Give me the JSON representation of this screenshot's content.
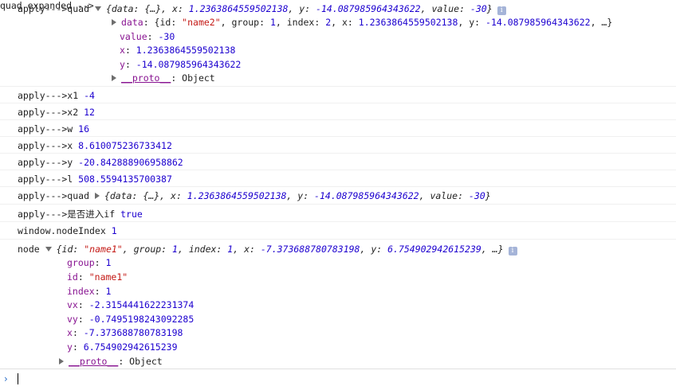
{
  "messages": {
    "m1": {
      "label": "apply--->quad ",
      "summary": {
        "p1": "{data: {…}, x: ",
        "x": "1.2363864559502138",
        "p2": ", y: ",
        "y": "-14.087985964343622",
        "p3": ", value: ",
        "value": "-30",
        "p4": "}"
      },
      "data_line": {
        "key": "data",
        "p1": ": {id: ",
        "id": "\"name2\"",
        "p2": ", group: ",
        "group": "1",
        "p3": ", index: ",
        "index": "2",
        "p4": ", x: ",
        "x": "1.2363864559502138",
        "p5": ", y: ",
        "y": "-14.087985964343622",
        "p6": ", …}"
      },
      "value_key": "value",
      "value_val": "-30",
      "x_key": "x",
      "x_val": "1.2363864559502138",
      "y_key": "y",
      "y_val": "-14.087985964343622",
      "proto_key": "__proto__",
      "proto_val": "Object"
    },
    "m2": {
      "label": "apply--->x1 ",
      "value": "-4"
    },
    "m3": {
      "label": "apply--->x2 ",
      "value": "12"
    },
    "m4": {
      "label": "apply--->w ",
      "value": "16"
    },
    "m5": {
      "label": "apply--->x ",
      "value": "8.610075236733412"
    },
    "m6": {
      "label": "apply--->y ",
      "value": "-20.842888906958862"
    },
    "m7": {
      "label": "apply--->l ",
      "value": "508.5594135700387"
    },
    "m8": {
      "label": "apply--->quad ",
      "p1": "{data: {…}, x: ",
      "x": "1.2363864559502138",
      "p2": ", y: ",
      "y": "-14.087985964343622",
      "p3": ", value: ",
      "value": "-30",
      "p4": "}"
    },
    "m9": {
      "label": "apply--->是否进入if ",
      "value": "true"
    },
    "m10": {
      "label": "window.nodeIndex ",
      "value": "1"
    },
    "m11": {
      "label": "node ",
      "summary": {
        "p1": "{id: ",
        "id": "\"name1\"",
        "p2": ", group: ",
        "group": "1",
        "p3": ", index: ",
        "index": "1",
        "p4": ", x: ",
        "x": "-7.373688780783198",
        "p5": ", y: ",
        "y": "6.754902942615239",
        "p6": ", …}"
      },
      "props": [
        {
          "key": "group",
          "val": "1",
          "kind": "num"
        },
        {
          "key": "id",
          "val": "\"name1\"",
          "kind": "str"
        },
        {
          "key": "index",
          "val": "1",
          "kind": "num"
        },
        {
          "key": "vx",
          "val": "-2.3154441622231374",
          "kind": "num"
        },
        {
          "key": "vy",
          "val": "-0.7495198243092285",
          "kind": "num"
        },
        {
          "key": "x",
          "val": "-7.373688780783198",
          "kind": "num"
        },
        {
          "key": "y",
          "val": "6.754902942615239",
          "kind": "num"
        }
      ],
      "proto_key": "__proto__",
      "proto_val": "Object"
    }
  },
  "icons": {
    "info": "info-icon",
    "expanded": "triangle-down-icon",
    "collapsed": "triangle-right-icon",
    "prompt": "prompt-chevron-icon"
  },
  "glyphs": {
    "info": "i",
    "prompt": "›"
  },
  "colors": {
    "number": "#1c00cf",
    "string": "#c41a16",
    "key": "#881391",
    "prompt": "#2a6ec8"
  }
}
